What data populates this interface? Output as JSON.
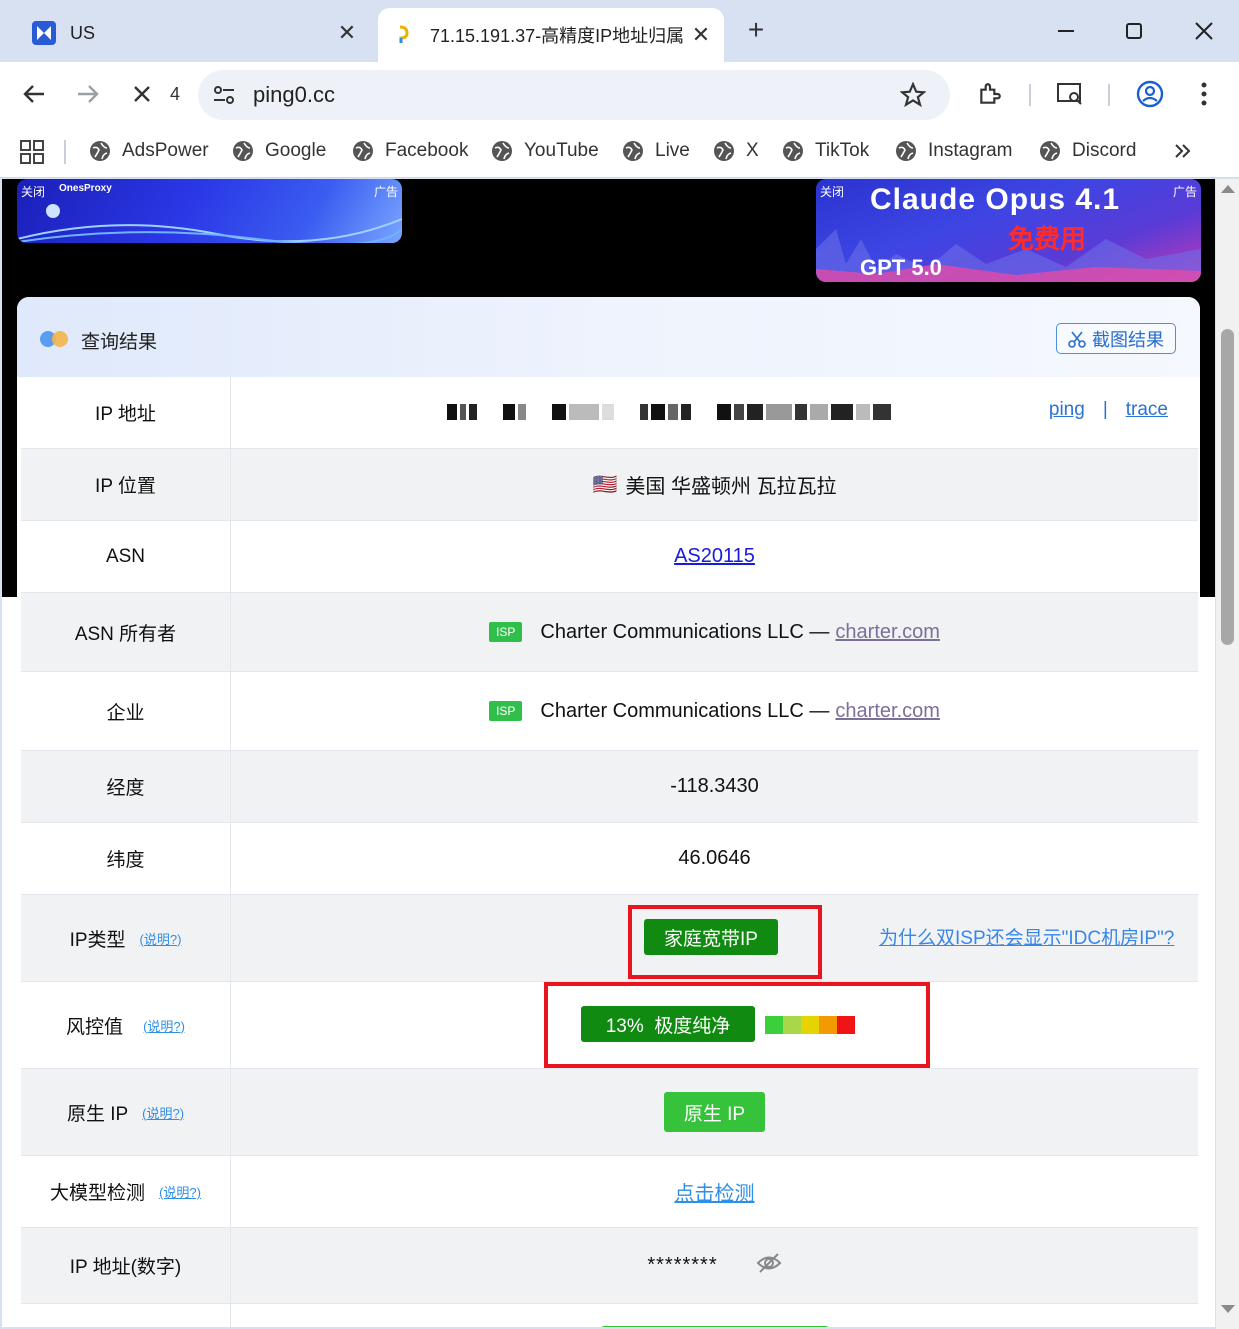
{
  "browser": {
    "tabs": [
      {
        "title": "US",
        "favicon": "adspower-logo-icon"
      },
      {
        "title": "71.15.191.37-高精度IP地址归属",
        "favicon": "ping0-favicon-icon"
      }
    ],
    "toolbar": {
      "reload_count": "4",
      "url": "ping0.cc"
    },
    "bookmarks": [
      {
        "label": "AdsPower"
      },
      {
        "label": "Google"
      },
      {
        "label": "Facebook"
      },
      {
        "label": "YouTube"
      },
      {
        "label": "Live"
      },
      {
        "label": "X"
      },
      {
        "label": "TikTok"
      },
      {
        "label": "Instagram"
      },
      {
        "label": "Discord"
      }
    ]
  },
  "ads": {
    "left": {
      "close_label": "关闭",
      "ad_label": "广告",
      "brand": "OnesProxy"
    },
    "right": {
      "close_label": "关闭",
      "ad_label": "广告",
      "title": "Claude Opus 4.1",
      "highlight": "免费用",
      "subtitle": "GPT 5.0"
    }
  },
  "card": {
    "title": "查询结果",
    "screenshot_button": "截图结果",
    "rows": {
      "ip_address": {
        "label": "IP 地址",
        "ping": "ping",
        "sep": "|",
        "trace": "trace"
      },
      "ip_location": {
        "label": "IP 位置",
        "flag": "🇺🇸",
        "value": "美国 华盛顿州 瓦拉瓦拉"
      },
      "asn": {
        "label": "ASN",
        "value": "AS20115"
      },
      "asn_owner": {
        "label": "ASN 所有者",
        "badge": "ISP",
        "value": "Charter Communications LLC —",
        "domain": "charter.com"
      },
      "enterprise": {
        "label": "企业",
        "badge": "ISP",
        "value": "Charter Communications LLC —",
        "domain": "charter.com"
      },
      "longitude": {
        "label": "经度",
        "value": "-118.3430"
      },
      "latitude": {
        "label": "纬度",
        "value": "46.0646"
      },
      "ip_type": {
        "label": "IP类型",
        "help": "(说明?)",
        "value": "家庭宽带IP",
        "why": "为什么双ISP还会显示\"IDC机房IP\"?"
      },
      "risk": {
        "label": "风控值",
        "help": "(说明?)",
        "value": "13%  极度纯净",
        "percent": 13,
        "scale_colors": [
          "#3ccf3c",
          "#a8d84a",
          "#e6d400",
          "#f39a00",
          "#f01414"
        ]
      },
      "native_ip": {
        "label": "原生 IP",
        "help": "(说明?)",
        "value": "原生 IP"
      },
      "llm_check": {
        "label": "大模型检测",
        "help": "(说明?)",
        "value": "点击检测"
      },
      "ip_numeric": {
        "label": "IP 地址(数字)",
        "value": "********"
      }
    }
  },
  "colors": {
    "accent_green": "#108a10",
    "light_green": "#36c23a",
    "highlight_red": "#e8141e",
    "link_blue": "#2a73d6"
  }
}
